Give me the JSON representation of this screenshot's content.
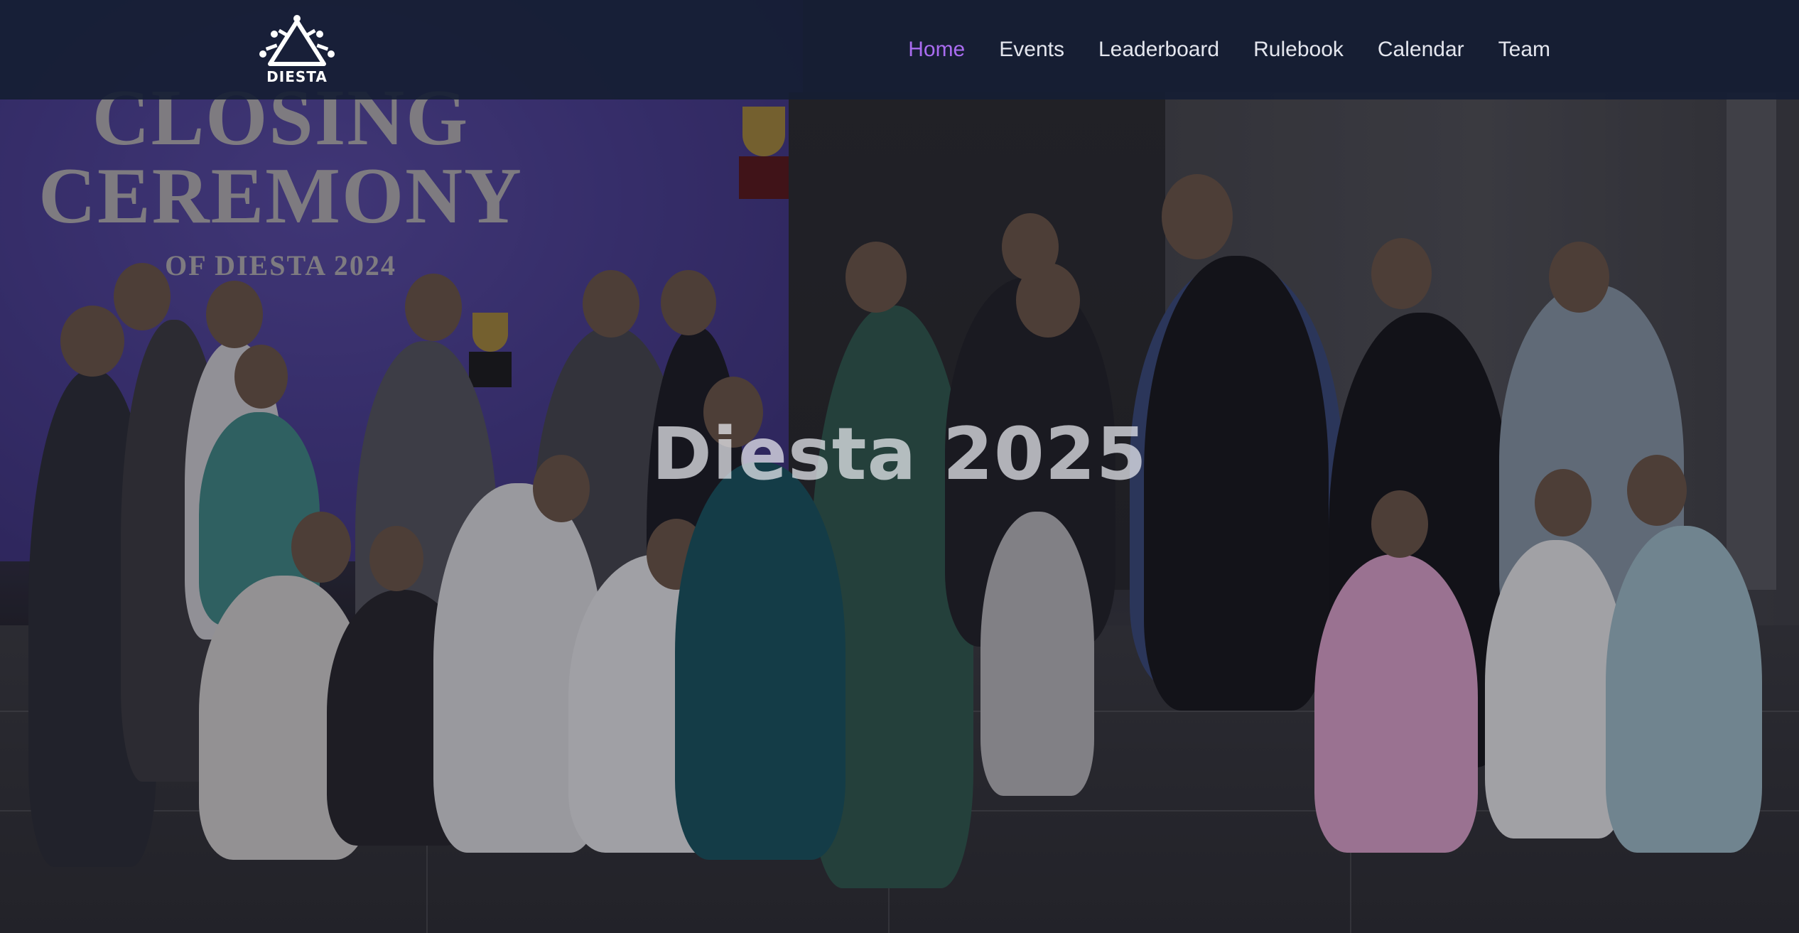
{
  "brand": {
    "logo_text": "DIESTA",
    "icon": "diesta-logo-icon"
  },
  "nav": {
    "items": [
      {
        "label": "Home",
        "active": true
      },
      {
        "label": "Events",
        "active": false
      },
      {
        "label": "Leaderboard",
        "active": false
      },
      {
        "label": "Rulebook",
        "active": false
      },
      {
        "label": "Calendar",
        "active": false
      },
      {
        "label": "Team",
        "active": false
      }
    ]
  },
  "hero": {
    "title": "Diesta 2025",
    "background_screen": {
      "line1": "CLOSING",
      "line2": "CEREMONY",
      "line3": "OF DIESTA 2024"
    }
  },
  "colors": {
    "navbar_bg": "#161e34",
    "nav_text": "#e4e6ee",
    "nav_active": "#a96cf0",
    "screen_purple": "#4a3d93"
  }
}
